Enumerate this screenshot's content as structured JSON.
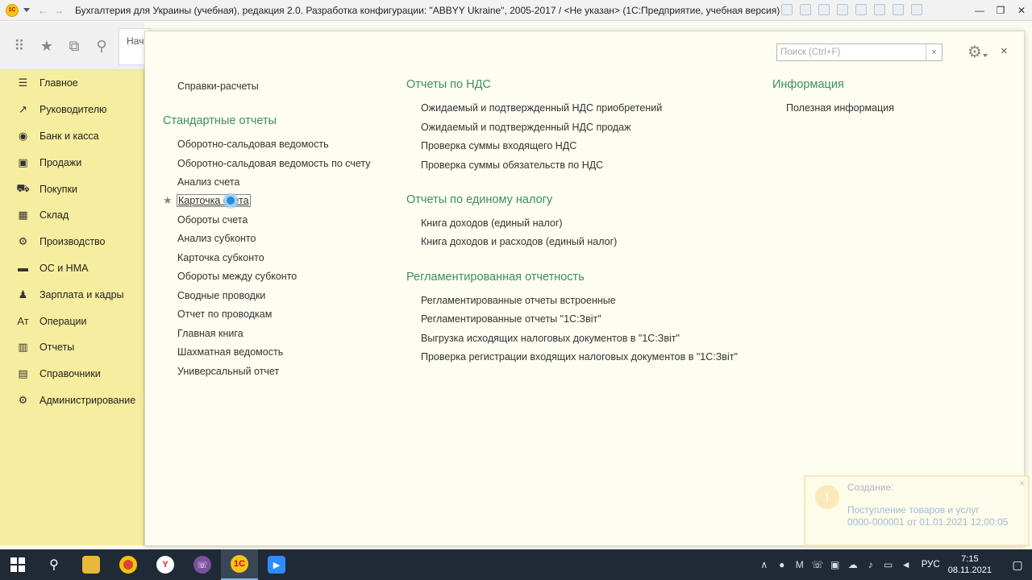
{
  "window": {
    "title": "Бухгалтерия для Украины (учебная), редакция 2.0. Разработка конфигурации: \"ABBYY Ukraine\", 2005-2017 / <Не указан>  (1С:Предприятие, учебная версия)",
    "logo_text": "1С"
  },
  "start_tab": "Нач",
  "sidebar": {
    "items": [
      {
        "label": "Главное",
        "icon": "menu-icon"
      },
      {
        "label": "Руководителю",
        "icon": "chart-line-icon"
      },
      {
        "label": "Банк и касса",
        "icon": "coin-icon"
      },
      {
        "label": "Продажи",
        "icon": "shopping-bag-icon"
      },
      {
        "label": "Покупки",
        "icon": "cart-icon"
      },
      {
        "label": "Склад",
        "icon": "warehouse-icon"
      },
      {
        "label": "Производство",
        "icon": "factory-icon"
      },
      {
        "label": "ОС и НМА",
        "icon": "building-icon"
      },
      {
        "label": "Зарплата и кадры",
        "icon": "person-icon"
      },
      {
        "label": "Операции",
        "icon": "operations-icon"
      },
      {
        "label": "Отчеты",
        "icon": "bar-chart-icon"
      },
      {
        "label": "Справочники",
        "icon": "book-icon"
      },
      {
        "label": "Администрирование",
        "icon": "gear-icon"
      }
    ]
  },
  "search": {
    "placeholder": "Поиск (Ctrl+F)",
    "clear": "×"
  },
  "panel_close": "×",
  "col1": {
    "top_link": "Справки-расчеты",
    "section_title": "Стандартные отчеты",
    "links": [
      "Оборотно-сальдовая ведомость",
      "Оборотно-сальдовая ведомость по счету",
      "Анализ счета",
      "Карточка счета",
      "Обороты счета",
      "Анализ субконто",
      "Карточка субконто",
      "Обороты между субконто",
      "Сводные проводки",
      "Отчет по проводкам",
      "Главная книга",
      "Шахматная ведомость",
      "Универсальный отчет"
    ]
  },
  "col2": {
    "sections": [
      {
        "title": "Отчеты по НДС",
        "links": [
          "Ожидаемый и подтвержденный НДС приобретений",
          "Ожидаемый и подтвержденный НДС продаж",
          "Проверка суммы входящего НДС",
          "Проверка суммы обязательств по НДС"
        ]
      },
      {
        "title": "Отчеты по единому налогу",
        "links": [
          "Книга доходов (единый налог)",
          "Книга доходов и расходов (единый налог)"
        ]
      },
      {
        "title": "Регламентированная отчетность",
        "links": [
          "Регламентированные отчеты встроенные",
          "Регламентированные отчеты \"1С:Звіт\"",
          "Выгрузка исходящих налоговых документов в \"1С:Звіт\"",
          "Проверка регистрации входящих налоговых документов в \"1С:Звіт\""
        ]
      }
    ]
  },
  "col3": {
    "section_title": "Информация",
    "links": [
      "Полезная информация"
    ]
  },
  "notification": {
    "title": "Создание:",
    "line1": "Поступление товаров и услуг",
    "line2": "0000-000001 от 01.01.2021 12:00:05",
    "close": "×"
  },
  "taskbar": {
    "lang": "РУС",
    "time": "7:15",
    "date": "08.11.2021"
  }
}
